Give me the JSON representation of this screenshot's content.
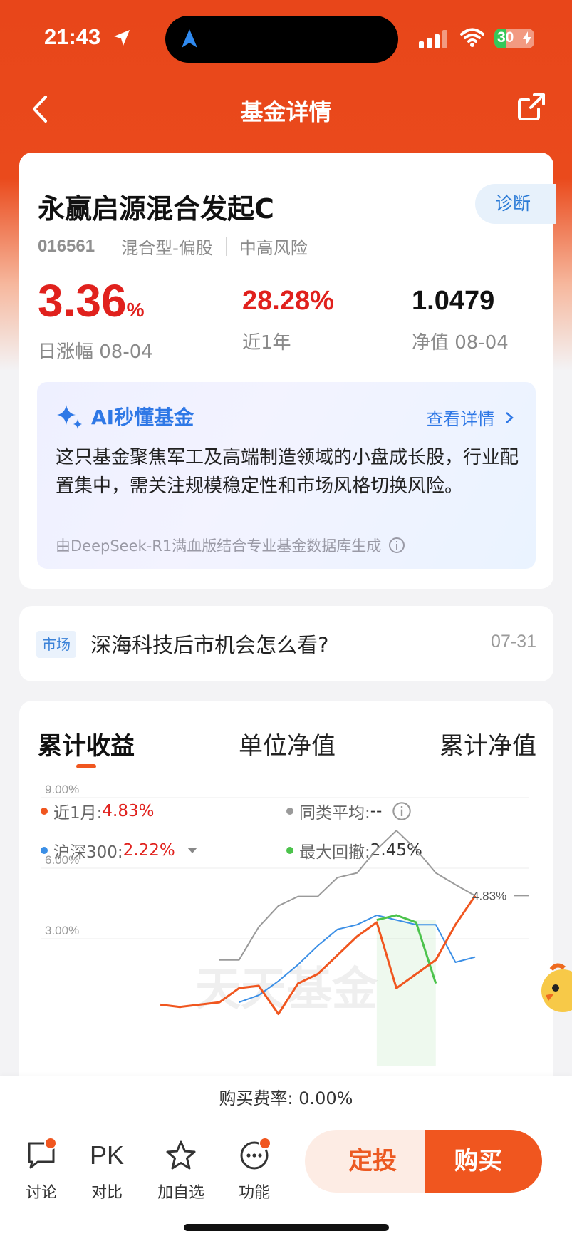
{
  "status_bar": {
    "time": "21:43",
    "battery": "30",
    "battery_level": 0.3
  },
  "nav": {
    "title": "基金详情"
  },
  "fund": {
    "name": "永赢启源混合发起C",
    "diagnose_label": "诊断",
    "code": "016561",
    "type": "混合型-偏股",
    "risk": "中高风险",
    "daily_change_value": "3.36",
    "daily_change_unit": "%",
    "daily_change_label": "日涨幅 08-04",
    "year_return": "28.28%",
    "year_return_label": "近1年",
    "nav_value": "1.0479",
    "nav_label": "净值 08-04"
  },
  "ai": {
    "title": "AI秒懂基金",
    "more": "查看详情",
    "text": "这只基金聚焦军工及高端制造领域的小盘成长股，行业配置集中，需关注规模稳定性和市场风格切换风险。",
    "source": "由DeepSeek-R1满血版结合专业基金数据库生成"
  },
  "news": {
    "tag": "市场",
    "title": "深海科技后市机会怎么看?",
    "date": "07-31"
  },
  "chart_tabs": [
    "累计收益",
    "单位净值",
    "累计净值"
  ],
  "legend": {
    "fund_label": "近1月:",
    "fund_value": "4.83%",
    "avg_label": "同类平均:",
    "avg_value": "--",
    "index_label": "沪深300:",
    "index_value": "2.22%",
    "drawdown_label": "最大回撤:",
    "drawdown_value": "2.45%"
  },
  "colors": {
    "fund": "#f0561f",
    "index": "#3b8fe6",
    "avg": "#9a9a9a",
    "drawdown": "#4cc34c",
    "accent": "#e8461a"
  },
  "chart_data": {
    "type": "line",
    "ylim": [
      0,
      9
    ],
    "yticks": [
      "9.00%",
      "6.00%",
      "3.00%"
    ],
    "watermark": "天天基金",
    "end_label": "4.83%",
    "x": [
      1,
      2,
      3,
      4,
      5,
      6,
      7,
      8,
      9,
      10,
      11,
      12,
      13,
      14,
      15,
      16,
      17,
      18,
      19,
      20,
      21,
      22
    ],
    "series": [
      {
        "name": "近1月",
        "values": [
          null,
          null,
          null,
          null,
          null,
          0.2,
          0.1,
          0.2,
          0.3,
          0.9,
          1.0,
          -0.2,
          1.1,
          1.5,
          2.3,
          3.1,
          3.7,
          0.9,
          1.5,
          2.1,
          3.6,
          4.83
        ]
      },
      {
        "name": "沪深300",
        "values": [
          null,
          null,
          null,
          null,
          null,
          null,
          null,
          null,
          null,
          0.3,
          0.6,
          1.2,
          1.9,
          2.7,
          3.4,
          3.6,
          4.0,
          3.8,
          3.6,
          3.6,
          2.0,
          2.22
        ]
      },
      {
        "name": "同类平均",
        "values": [
          null,
          null,
          null,
          null,
          null,
          null,
          null,
          null,
          2.1,
          2.1,
          3.5,
          4.4,
          4.8,
          4.8,
          5.6,
          5.8,
          6.8,
          7.6,
          6.8,
          5.8,
          5.3,
          4.83
        ]
      },
      {
        "name": "最大回撤",
        "values": [
          null,
          null,
          null,
          null,
          null,
          null,
          null,
          null,
          null,
          null,
          null,
          null,
          null,
          null,
          null,
          null,
          3.8,
          4.0,
          3.7,
          1.1,
          null,
          null
        ]
      }
    ]
  },
  "fee": {
    "text": "购买费率: 0.00%"
  },
  "toolbar": {
    "discuss": "讨论",
    "pk_icon": "PK",
    "compare": "对比",
    "watch": "加自选",
    "func": "功能",
    "plan": "定投",
    "buy": "购买"
  }
}
